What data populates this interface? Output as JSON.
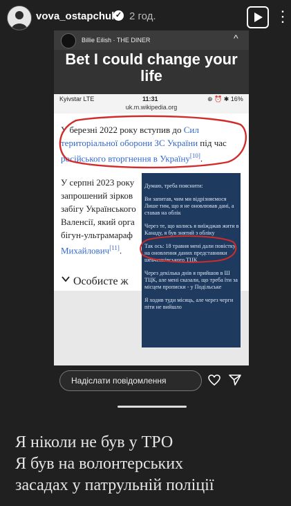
{
  "header": {
    "username": "vova_ostapchuk",
    "verified_icon": "check-icon",
    "time_ago": "2 год.",
    "more_label": "⋮"
  },
  "music": {
    "track": "Billie Eilish · THE DINER",
    "close_label": "^"
  },
  "quote": "Bet I could change your life",
  "phone_status": {
    "carrier": "Kyivstar  LTE",
    "time": "11:31",
    "icons": "⊕ ⏰ ✱ 16%"
  },
  "url": "uk.m.wikipedia.org",
  "article": {
    "p1_a": "У березні 2022 року вступив до ",
    "p1_link1": "Сил територіальної оборони ЗС України",
    "p1_b": " під час ",
    "p1_link2": "російського вторгнення в Україну",
    "p1_ref": "[10]",
    "p1_end": ".",
    "p2_line1": "У серпні 2023 року",
    "p2_line2": "запрошений зірков",
    "p2_line3": "забігу Українського",
    "p2_line4": "Валенсії, який орга",
    "p2_line5": "бігун-ультрамараф",
    "p2_link": "Михайлович",
    "p2_ref": "[11]",
    "p2_end": ".",
    "section": "Особисте ж"
  },
  "note": {
    "p1": "Думаю, треба пояснити:",
    "p2": "Ви запитав, чим ми відрізняємося Лише тим, що я не оновлював дані, а ставав на облік",
    "p3": "Через те, що колись я виїжджав жити в Канаду, я був знятий з обліку",
    "p4": "Так ось: 18 травня мені дали повістку на оновлення даних представники шевченківського ТЦК",
    "p5": "Через декілька днів я прийшов в Ш ТЦК, але мені сказали, що треба їти за місцем прописки - у Подільське",
    "p6": "Я ходив туди місяць, але через черги піти не вийшло"
  },
  "message": {
    "placeholder": "Надіслати повідомлення"
  },
  "caption": {
    "line1": "Я ніколи не був у ТРО",
    "line2": "Я був на волонтерських",
    "line3": "засадах у патрульній поліції"
  },
  "colors": {
    "link": "#3366cc",
    "highlight": "#d12b2b",
    "note_bg": "#1f3a5f"
  }
}
